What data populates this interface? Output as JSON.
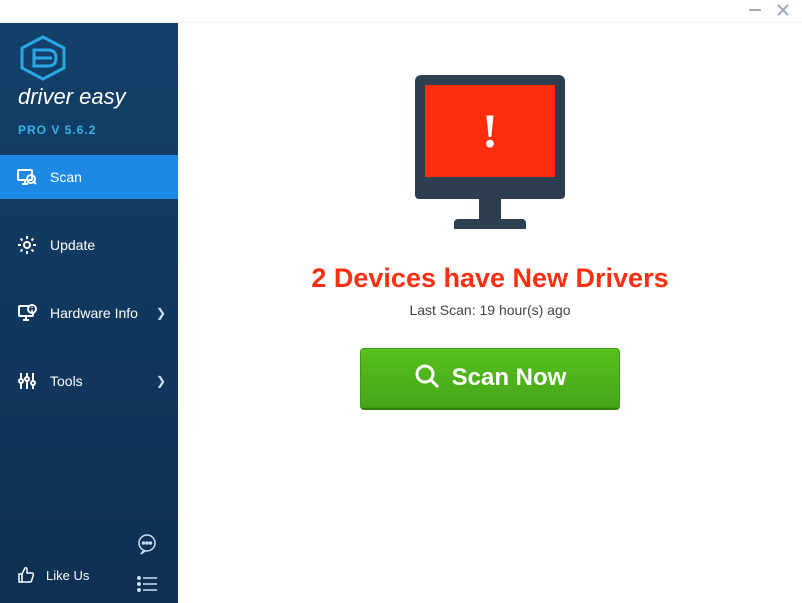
{
  "version": "PRO V 5.6.2",
  "nav": {
    "scan": {
      "label": "Scan"
    },
    "update": {
      "label": "Update"
    },
    "hw": {
      "label": "Hardware Info"
    },
    "tools": {
      "label": "Tools"
    }
  },
  "bottom": {
    "like_label": "Like Us"
  },
  "main": {
    "status": "2 Devices have New Drivers",
    "last_scan": "Last Scan: 19 hour(s) ago",
    "scan_btn": "Scan Now"
  },
  "colors": {
    "accent": "#1e88e5",
    "danger": "#ff2e0f",
    "action": "#4eb31a"
  }
}
